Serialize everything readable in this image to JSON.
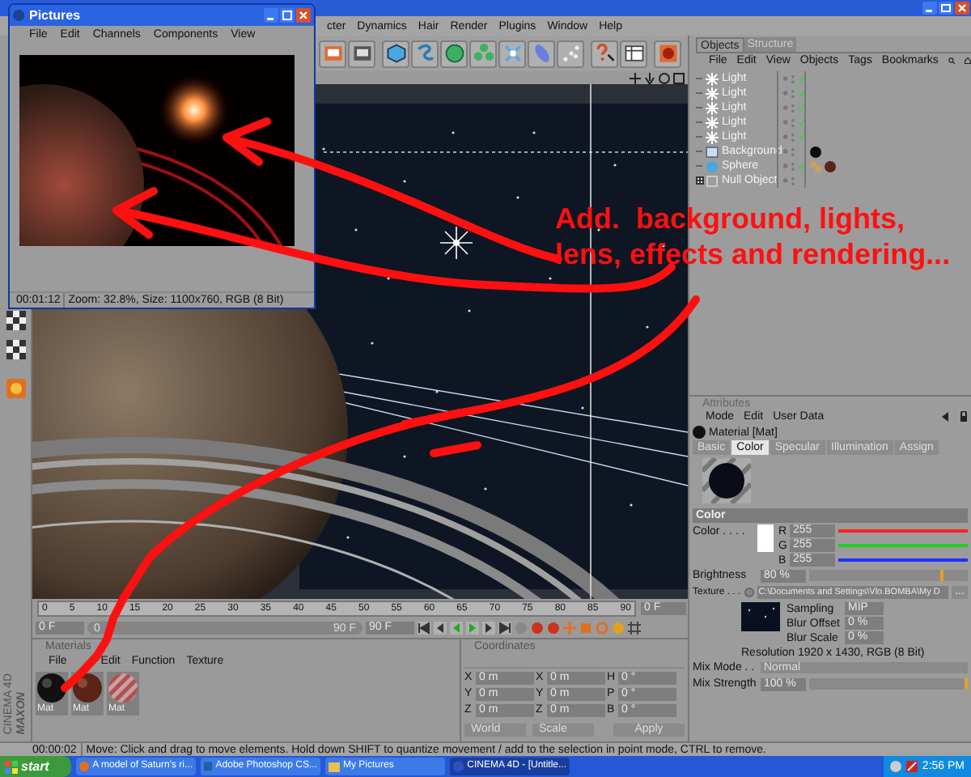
{
  "main_window": {
    "menu": [
      "cter",
      "Dynamics",
      "Hair",
      "Render",
      "Plugins",
      "Window",
      "Help"
    ]
  },
  "pictures_window": {
    "title": "Pictures",
    "menu": [
      "File",
      "Edit",
      "Channels",
      "Components",
      "View"
    ],
    "time": "00:01:12",
    "info": "Zoom: 32.8%, Size: 1100x760, RGB (8 Bit)"
  },
  "objects_panel": {
    "tabs": [
      {
        "label": "Objects",
        "selected": true
      },
      {
        "label": "Structure",
        "selected": false
      }
    ],
    "menu": [
      "File",
      "Edit",
      "View",
      "Objects",
      "Tags",
      "Bookmarks"
    ],
    "items": [
      {
        "name": "Light",
        "kind": "light",
        "checked": true
      },
      {
        "name": "Light",
        "kind": "light",
        "checked": true
      },
      {
        "name": "Light",
        "kind": "light",
        "checked": true
      },
      {
        "name": "Light",
        "kind": "light",
        "checked": true
      },
      {
        "name": "Light",
        "kind": "light",
        "checked": true
      },
      {
        "name": "Background",
        "kind": "background",
        "checked": false,
        "tags": [
          {
            "kind": "material",
            "color": "#0a0a0a"
          }
        ]
      },
      {
        "name": "Sphere",
        "kind": "sphere",
        "checked": true,
        "tags": [
          {
            "kind": "uvw"
          },
          {
            "kind": "material",
            "color": "#5a2418"
          }
        ]
      },
      {
        "name": "Null Object",
        "kind": "null",
        "checked": false
      }
    ]
  },
  "attributes": {
    "title": "Attributes",
    "menu": [
      "Mode",
      "Edit",
      "User Data"
    ],
    "object": "Material [Mat]",
    "tabs": [
      {
        "label": "Basic",
        "selected": false
      },
      {
        "label": "Color",
        "selected": true
      },
      {
        "label": "Specular",
        "selected": false
      },
      {
        "label": "Illumination",
        "selected": false
      },
      {
        "label": "Assign",
        "selected": false
      }
    ],
    "section": "Color",
    "color_label": "Color . . . .",
    "channels": [
      {
        "name": "R",
        "value": "255",
        "level": 1,
        "color": "#ff2020"
      },
      {
        "name": "G",
        "value": "255",
        "level": 1,
        "color": "#20d020"
      },
      {
        "name": "B",
        "value": "255",
        "level": 1,
        "color": "#2030ff"
      }
    ],
    "brightness": {
      "label": "Brightness",
      "value": "80 %",
      "level": 0.85
    },
    "texture": {
      "label": "Texture . . .",
      "path": "C:\\Documents and Settings\\Vlo.BOMBA\\My D",
      "button": "..."
    },
    "sampling": {
      "label": "Sampling",
      "value": "MIP"
    },
    "blur_offset": {
      "label": "Blur Offset",
      "value": "0 %"
    },
    "blur_scale": {
      "label": "Blur Scale",
      "value": "0 %"
    },
    "resolution": "Resolution 1920 x 1430, RGB (8 Bit)",
    "mix_mode": {
      "label": "Mix Mode . .",
      "value": "Normal"
    },
    "mix_strength": {
      "label": "Mix Strength",
      "value": "100 %",
      "level": 1
    }
  },
  "timeline": {
    "ticks": [
      "0",
      "5",
      "10",
      "15",
      "20",
      "25",
      "30",
      "35",
      "40",
      "45",
      "50",
      "55",
      "60",
      "65",
      "70",
      "75",
      "80",
      "85",
      "90"
    ],
    "current": "0 F",
    "start": "0 F",
    "slider_start": "0",
    "slider_end": "90 F",
    "end": "90 F"
  },
  "materials": {
    "title": "Materials",
    "menu": [
      "File",
      "Edit",
      "Function",
      "Texture"
    ],
    "items": [
      {
        "name": "Mat",
        "kind": "dark"
      },
      {
        "name": "Mat",
        "kind": "brown"
      },
      {
        "name": "Mat",
        "kind": "striped"
      }
    ]
  },
  "coordinates": {
    "title": "Coordinates",
    "rows": [
      {
        "axis": "X",
        "position": "0 m",
        "size_axis": "X",
        "size": "0 m",
        "rot_axis": "H",
        "rotation": "0 °"
      },
      {
        "axis": "Y",
        "position": "0 m",
        "size_axis": "Y",
        "size": "0 m",
        "rot_axis": "P",
        "rotation": "0 °"
      },
      {
        "axis": "Z",
        "position": "0 m",
        "size_axis": "Z",
        "size": "0 m",
        "rot_axis": "B",
        "rotation": "0 °"
      }
    ],
    "dropdowns": [
      "World",
      "Scale"
    ],
    "apply": "Apply"
  },
  "status_bar": {
    "time": "00:00:02",
    "message": "Move: Click and drag to move elements. Hold down SHIFT to quantize movement / add to the selection in point mode, CTRL to remove."
  },
  "logo": {
    "brand": "MAXON",
    "product": "CINEMA 4D"
  },
  "annotation": {
    "text": "Add.  background, lights, lens, effects and rendering..."
  },
  "taskbar": {
    "start": "start",
    "tasks": [
      {
        "label": "A model of Saturn's ri...",
        "kind": "browser",
        "selected": false
      },
      {
        "label": "Adobe Photoshop CS...",
        "kind": "photoshop",
        "selected": false
      },
      {
        "label": "My Pictures",
        "kind": "folder",
        "selected": false
      },
      {
        "label": "CINEMA 4D - [Untitle...",
        "kind": "cinema",
        "selected": true
      }
    ],
    "clock": "2:56 PM"
  }
}
